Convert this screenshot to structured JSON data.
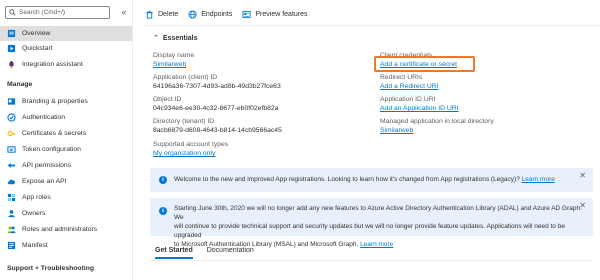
{
  "search": {
    "placeholder": "Search (Cmd+/)"
  },
  "sidebar": {
    "top_items": [
      {
        "label": "Overview",
        "icon": "overview-icon"
      },
      {
        "label": "Quickstart",
        "icon": "quickstart-icon"
      },
      {
        "label": "Integration assistant",
        "icon": "rocket-icon"
      }
    ],
    "manage_header": "Manage",
    "manage_items": [
      {
        "label": "Branding & properties",
        "icon": "branding-icon"
      },
      {
        "label": "Authentication",
        "icon": "authentication-icon"
      },
      {
        "label": "Certificates & secrets",
        "icon": "key-icon"
      },
      {
        "label": "Token configuration",
        "icon": "token-icon"
      },
      {
        "label": "API permissions",
        "icon": "api-permissions-icon"
      },
      {
        "label": "Expose an API",
        "icon": "cloud-icon"
      },
      {
        "label": "App roles",
        "icon": "app-roles-icon"
      },
      {
        "label": "Owners",
        "icon": "owners-icon"
      },
      {
        "label": "Roles and administrators",
        "icon": "roles-icon"
      },
      {
        "label": "Manifest",
        "icon": "manifest-icon"
      }
    ],
    "support_header": "Support + Troubleshooting"
  },
  "toolbar": {
    "delete_label": "Delete",
    "endpoints_label": "Endpoints",
    "preview_label": "Preview features"
  },
  "essentials": {
    "title": "Essentials",
    "display_name_label": "Display name",
    "display_name_value": "Similarweb",
    "app_id_label": "Application (client) ID",
    "app_id_value": "64196a36-7307-4d93-ad8b-49d3b27fce63",
    "object_id_label": "Object ID",
    "object_id_value": "04c934e6-ee30-4c32-8677-eb0f02efb82a",
    "tenant_id_label": "Directory (tenant) ID",
    "tenant_id_value": "8acb6879-d608-4643-b814-14cb9566ac45",
    "account_types_label": "Supported account types",
    "account_types_value": "My organization only",
    "client_credentials_label": "Client credentials",
    "client_credentials_value": "Add a certificate or secret",
    "redirect_uris_label": "Redirect URIs",
    "redirect_uris_value": "Add a Redirect URI",
    "app_id_uri_label": "Application ID URI",
    "app_id_uri_value": "Add an Application ID URI",
    "managed_app_label": "Managed application in local directory",
    "managed_app_value": "Similarweb"
  },
  "banners": {
    "welcome_text": "Welcome to the new and improved App registrations. Looking to learn how it's changed from App registrations (Legacy)?",
    "welcome_link": "Learn more",
    "adal_line1": "Starting June 30th, 2020 we will no longer add any new features to Azure Active Directory Authentication Library (ADAL) and Azure AD Graph. We",
    "adal_line2": "will continue to provide technical support and security updates but we will no longer provide feature updates. Applications will need to be upgraded",
    "adal_line3": "to Microsoft Authentication Library (MSAL) and Microsoft Graph.",
    "adal_link": "Learn more"
  },
  "tabs": [
    {
      "label": "Get Started"
    },
    {
      "label": "Documentation"
    }
  ],
  "colors": {
    "accent": "#0078d4",
    "highlight": "#ea7a2b",
    "banner_bg": "#e8f1fb",
    "active_nav_bg": "#e1dfdd"
  }
}
